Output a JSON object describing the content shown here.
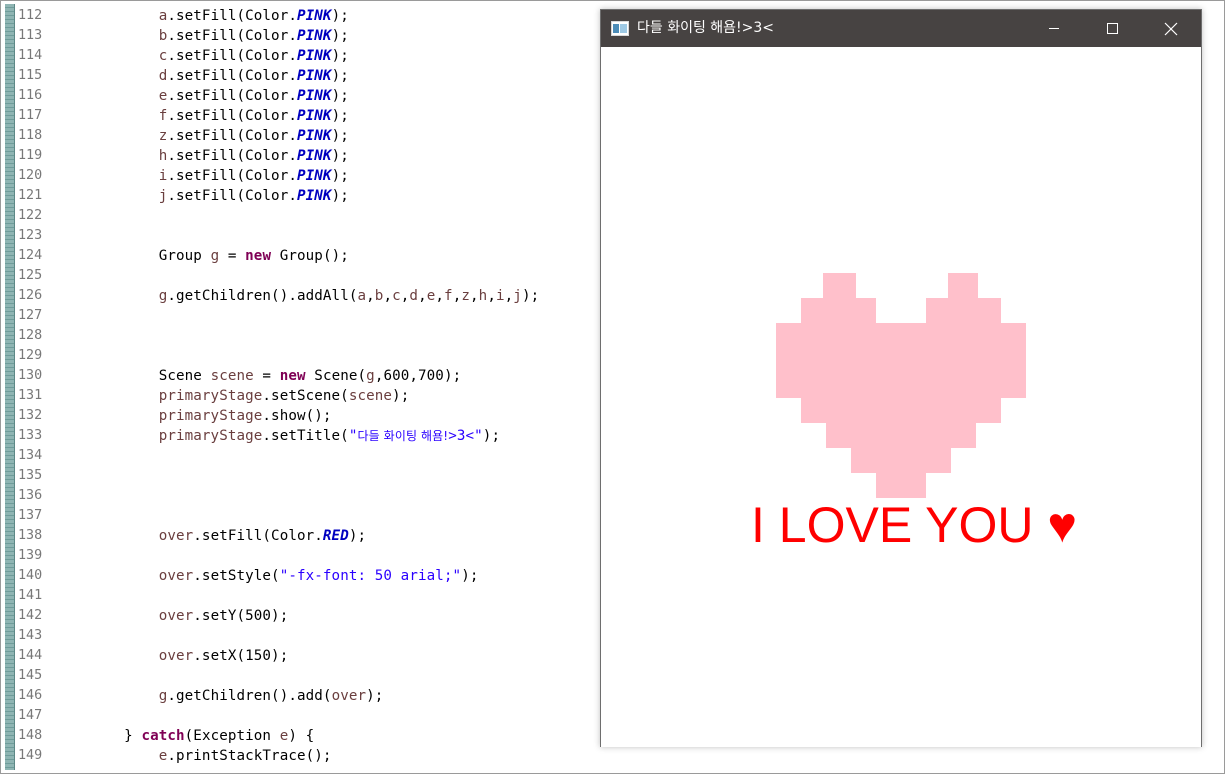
{
  "editor": {
    "lines": [
      {
        "num": "112",
        "tokens": [
          {
            "t": "sp",
            "v": "            "
          },
          {
            "t": "var",
            "v": "a"
          },
          {
            "t": "plain",
            "v": ".setFill(Color."
          },
          {
            "t": "const",
            "v": "PINK"
          },
          {
            "t": "plain",
            "v": ");"
          }
        ]
      },
      {
        "num": "113",
        "tokens": [
          {
            "t": "sp",
            "v": "            "
          },
          {
            "t": "var",
            "v": "b"
          },
          {
            "t": "plain",
            "v": ".setFill(Color."
          },
          {
            "t": "const",
            "v": "PINK"
          },
          {
            "t": "plain",
            "v": ");"
          }
        ]
      },
      {
        "num": "114",
        "tokens": [
          {
            "t": "sp",
            "v": "            "
          },
          {
            "t": "var",
            "v": "c"
          },
          {
            "t": "plain",
            "v": ".setFill(Color."
          },
          {
            "t": "const",
            "v": "PINK"
          },
          {
            "t": "plain",
            "v": ");"
          }
        ]
      },
      {
        "num": "115",
        "tokens": [
          {
            "t": "sp",
            "v": "            "
          },
          {
            "t": "var",
            "v": "d"
          },
          {
            "t": "plain",
            "v": ".setFill(Color."
          },
          {
            "t": "const",
            "v": "PINK"
          },
          {
            "t": "plain",
            "v": ");"
          }
        ]
      },
      {
        "num": "116",
        "tokens": [
          {
            "t": "sp",
            "v": "            "
          },
          {
            "t": "var",
            "v": "e"
          },
          {
            "t": "plain",
            "v": ".setFill(Color."
          },
          {
            "t": "const",
            "v": "PINK"
          },
          {
            "t": "plain",
            "v": ");"
          }
        ]
      },
      {
        "num": "117",
        "tokens": [
          {
            "t": "sp",
            "v": "            "
          },
          {
            "t": "var",
            "v": "f"
          },
          {
            "t": "plain",
            "v": ".setFill(Color."
          },
          {
            "t": "const",
            "v": "PINK"
          },
          {
            "t": "plain",
            "v": ");"
          }
        ]
      },
      {
        "num": "118",
        "tokens": [
          {
            "t": "sp",
            "v": "            "
          },
          {
            "t": "var",
            "v": "z"
          },
          {
            "t": "plain",
            "v": ".setFill(Color."
          },
          {
            "t": "const",
            "v": "PINK"
          },
          {
            "t": "plain",
            "v": ");"
          }
        ]
      },
      {
        "num": "119",
        "tokens": [
          {
            "t": "sp",
            "v": "            "
          },
          {
            "t": "var",
            "v": "h"
          },
          {
            "t": "plain",
            "v": ".setFill(Color."
          },
          {
            "t": "const",
            "v": "PINK"
          },
          {
            "t": "plain",
            "v": ");"
          }
        ]
      },
      {
        "num": "120",
        "tokens": [
          {
            "t": "sp",
            "v": "            "
          },
          {
            "t": "var",
            "v": "i"
          },
          {
            "t": "plain",
            "v": ".setFill(Color."
          },
          {
            "t": "const",
            "v": "PINK"
          },
          {
            "t": "plain",
            "v": ");"
          }
        ]
      },
      {
        "num": "121",
        "tokens": [
          {
            "t": "sp",
            "v": "            "
          },
          {
            "t": "var",
            "v": "j"
          },
          {
            "t": "plain",
            "v": ".setFill(Color."
          },
          {
            "t": "const",
            "v": "PINK"
          },
          {
            "t": "plain",
            "v": ");"
          }
        ]
      },
      {
        "num": "122",
        "tokens": []
      },
      {
        "num": "123",
        "tokens": []
      },
      {
        "num": "124",
        "tokens": [
          {
            "t": "sp",
            "v": "            "
          },
          {
            "t": "plain",
            "v": "Group "
          },
          {
            "t": "var",
            "v": "g"
          },
          {
            "t": "plain",
            "v": " = "
          },
          {
            "t": "kw",
            "v": "new"
          },
          {
            "t": "plain",
            "v": " Group();"
          }
        ]
      },
      {
        "num": "125",
        "tokens": []
      },
      {
        "num": "126",
        "tokens": [
          {
            "t": "sp",
            "v": "            "
          },
          {
            "t": "var",
            "v": "g"
          },
          {
            "t": "plain",
            "v": ".getChildren().addAll("
          },
          {
            "t": "var",
            "v": "a"
          },
          {
            "t": "plain",
            "v": ","
          },
          {
            "t": "var",
            "v": "b"
          },
          {
            "t": "plain",
            "v": ","
          },
          {
            "t": "var",
            "v": "c"
          },
          {
            "t": "plain",
            "v": ","
          },
          {
            "t": "var",
            "v": "d"
          },
          {
            "t": "plain",
            "v": ","
          },
          {
            "t": "var",
            "v": "e"
          },
          {
            "t": "plain",
            "v": ","
          },
          {
            "t": "var",
            "v": "f"
          },
          {
            "t": "plain",
            "v": ","
          },
          {
            "t": "var",
            "v": "z"
          },
          {
            "t": "plain",
            "v": ","
          },
          {
            "t": "var",
            "v": "h"
          },
          {
            "t": "plain",
            "v": ","
          },
          {
            "t": "var",
            "v": "i"
          },
          {
            "t": "plain",
            "v": ","
          },
          {
            "t": "var",
            "v": "j"
          },
          {
            "t": "plain",
            "v": ");"
          }
        ]
      },
      {
        "num": "127",
        "tokens": []
      },
      {
        "num": "128",
        "tokens": []
      },
      {
        "num": "129",
        "tokens": []
      },
      {
        "num": "130",
        "tokens": [
          {
            "t": "sp",
            "v": "            "
          },
          {
            "t": "plain",
            "v": "Scene "
          },
          {
            "t": "var",
            "v": "scene"
          },
          {
            "t": "plain",
            "v": " = "
          },
          {
            "t": "kw",
            "v": "new"
          },
          {
            "t": "plain",
            "v": " Scene("
          },
          {
            "t": "var",
            "v": "g"
          },
          {
            "t": "plain",
            "v": ",600,700);"
          }
        ]
      },
      {
        "num": "131",
        "tokens": [
          {
            "t": "sp",
            "v": "            "
          },
          {
            "t": "var",
            "v": "primaryStage"
          },
          {
            "t": "plain",
            "v": ".setScene("
          },
          {
            "t": "var",
            "v": "scene"
          },
          {
            "t": "plain",
            "v": ");"
          }
        ]
      },
      {
        "num": "132",
        "tokens": [
          {
            "t": "sp",
            "v": "            "
          },
          {
            "t": "var",
            "v": "primaryStage"
          },
          {
            "t": "plain",
            "v": ".show();"
          }
        ]
      },
      {
        "num": "133",
        "tokens": [
          {
            "t": "sp",
            "v": "            "
          },
          {
            "t": "var",
            "v": "primaryStage"
          },
          {
            "t": "plain",
            "v": ".setTitle("
          },
          {
            "t": "str",
            "v": "\""
          },
          {
            "t": "kor",
            "v": "다들 화이팅 해욤!"
          },
          {
            "t": "str",
            "v": ">3<\""
          },
          {
            "t": "plain",
            "v": ");"
          }
        ]
      },
      {
        "num": "134",
        "tokens": []
      },
      {
        "num": "135",
        "tokens": []
      },
      {
        "num": "136",
        "tokens": []
      },
      {
        "num": "137",
        "tokens": []
      },
      {
        "num": "138",
        "tokens": [
          {
            "t": "sp",
            "v": "            "
          },
          {
            "t": "var",
            "v": "over"
          },
          {
            "t": "plain",
            "v": ".setFill(Color."
          },
          {
            "t": "const",
            "v": "RED"
          },
          {
            "t": "plain",
            "v": ");"
          }
        ]
      },
      {
        "num": "139",
        "tokens": []
      },
      {
        "num": "140",
        "tokens": [
          {
            "t": "sp",
            "v": "            "
          },
          {
            "t": "var",
            "v": "over"
          },
          {
            "t": "plain",
            "v": ".setStyle("
          },
          {
            "t": "str",
            "v": "\"-fx-font: 50 arial;\""
          },
          {
            "t": "plain",
            "v": ");"
          }
        ]
      },
      {
        "num": "141",
        "tokens": []
      },
      {
        "num": "142",
        "tokens": [
          {
            "t": "sp",
            "v": "            "
          },
          {
            "t": "var",
            "v": "over"
          },
          {
            "t": "plain",
            "v": ".setY(500);"
          }
        ]
      },
      {
        "num": "143",
        "tokens": []
      },
      {
        "num": "144",
        "tokens": [
          {
            "t": "sp",
            "v": "            "
          },
          {
            "t": "var",
            "v": "over"
          },
          {
            "t": "plain",
            "v": ".setX(150);"
          }
        ]
      },
      {
        "num": "145",
        "tokens": []
      },
      {
        "num": "146",
        "tokens": [
          {
            "t": "sp",
            "v": "            "
          },
          {
            "t": "var",
            "v": "g"
          },
          {
            "t": "plain",
            "v": ".getChildren().add("
          },
          {
            "t": "var",
            "v": "over"
          },
          {
            "t": "plain",
            "v": ");"
          }
        ]
      },
      {
        "num": "147",
        "tokens": []
      },
      {
        "num": "148",
        "tokens": [
          {
            "t": "sp",
            "v": "        "
          },
          {
            "t": "plain",
            "v": "} "
          },
          {
            "t": "kw",
            "v": "catch"
          },
          {
            "t": "plain",
            "v": "(Exception "
          },
          {
            "t": "var",
            "v": "e"
          },
          {
            "t": "plain",
            "v": ") {"
          }
        ]
      },
      {
        "num": "149",
        "tokens": [
          {
            "t": "sp",
            "v": "            "
          },
          {
            "t": "var",
            "v": "e"
          },
          {
            "t": "plain",
            "v": ".printStackTrace();"
          }
        ]
      }
    ]
  },
  "window": {
    "title": "다들 화이팅 해욤!>3<",
    "titlebar_color": "#474342",
    "icons": {
      "app": "app-window-icon",
      "minimize": "minimize-icon",
      "maximize": "maximize-icon",
      "close": "close-icon"
    }
  },
  "scene": {
    "text": "I LOVE YOU ♥",
    "text_color": "#ff0000",
    "heart_color": "#ffc0cb"
  }
}
